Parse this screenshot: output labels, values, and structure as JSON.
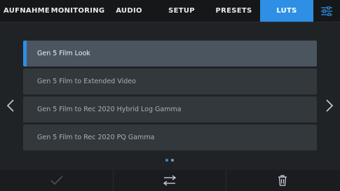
{
  "tabs": [
    {
      "label": "AUFNAHME",
      "active": false
    },
    {
      "label": "MONITORING",
      "active": false
    },
    {
      "label": "AUDIO",
      "active": false
    },
    {
      "label": "SETUP",
      "active": false
    },
    {
      "label": "PRESETS",
      "active": false
    },
    {
      "label": "LUTS",
      "active": true
    }
  ],
  "settings_icon": "sliders-icon",
  "luts": [
    {
      "label": "Gen 5 Film Look",
      "selected": true
    },
    {
      "label": "Gen 5 Film to Extended Video",
      "selected": false
    },
    {
      "label": "Gen 5 Film to Rec 2020 Hybrid Log Gamma",
      "selected": false
    },
    {
      "label": "Gen 5 Film to Rec 2020 PQ Gamma",
      "selected": false
    }
  ],
  "pagination": {
    "current_page": 1,
    "total_pages": 2
  },
  "bottom_actions": [
    "checkmark-icon",
    "swap-arrows-icon",
    "trash-icon"
  ],
  "colors": {
    "accent": "#2e8fe5",
    "background": "#202326",
    "topbar": "#151719"
  }
}
